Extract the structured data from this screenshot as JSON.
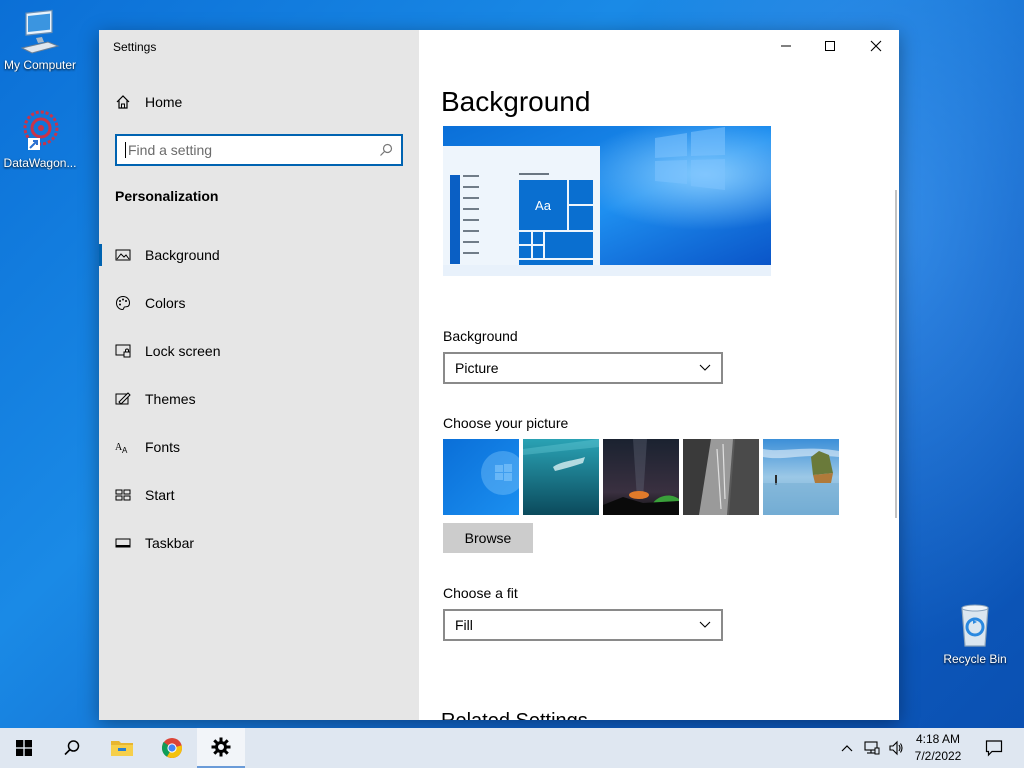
{
  "desktop": {
    "icons": [
      {
        "label": "My Computer",
        "icon": "computer-icon"
      },
      {
        "label": "DataWagon...",
        "icon": "datawagon-icon"
      },
      {
        "label": "Recycle Bin",
        "icon": "recycle-bin-icon"
      }
    ]
  },
  "window": {
    "title": "Settings",
    "controls": [
      "minimize-icon",
      "maximize-icon",
      "close-icon"
    ]
  },
  "sidebar": {
    "home_label": "Home",
    "search_placeholder": "Find a setting",
    "section_title": "Personalization",
    "items": [
      {
        "label": "Background",
        "icon": "picture-icon",
        "active": true
      },
      {
        "label": "Colors",
        "icon": "palette-icon",
        "active": false
      },
      {
        "label": "Lock screen",
        "icon": "lock-screen-icon",
        "active": false
      },
      {
        "label": "Themes",
        "icon": "themes-icon",
        "active": false
      },
      {
        "label": "Fonts",
        "icon": "fonts-icon",
        "active": false
      },
      {
        "label": "Start",
        "icon": "start-icon",
        "active": false
      },
      {
        "label": "Taskbar",
        "icon": "taskbar-icon",
        "active": false
      }
    ]
  },
  "content": {
    "page_title": "Background",
    "preview_tile_text": "Aa",
    "background_label": "Background",
    "background_value": "Picture",
    "choose_picture_label": "Choose your picture",
    "browse_label": "Browse",
    "choose_fit_label": "Choose a fit",
    "fit_value": "Fill",
    "related_settings": "Related Settings"
  },
  "taskbar": {
    "buttons": [
      "start-icon",
      "search-icon",
      "file-explorer-icon",
      "chrome-icon",
      "settings-gear-icon"
    ],
    "time": "4:18 AM",
    "date": "7/2/2022"
  },
  "colors": {
    "accent": "#0063b1",
    "sidebar_bg": "#e6e6e6",
    "taskbar_bg": "#dfe7f1"
  }
}
